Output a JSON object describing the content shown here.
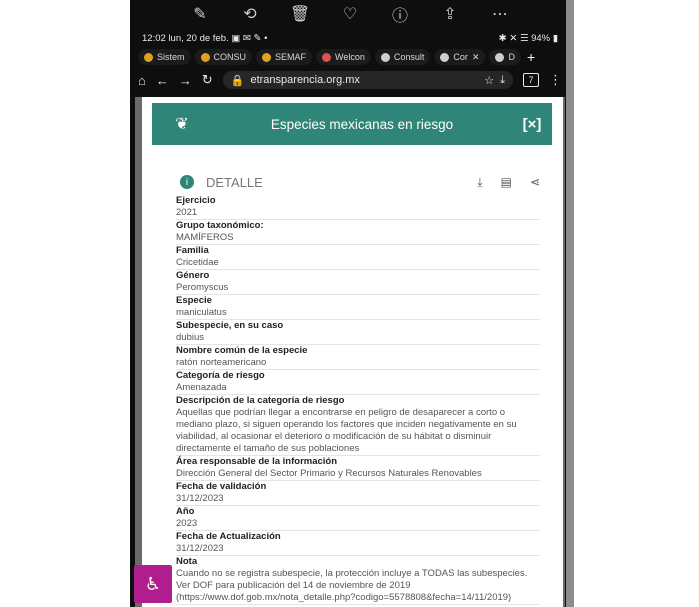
{
  "toolbar": {
    "icons": [
      "edit-icon",
      "rotate-icon",
      "trash-icon",
      "heart-icon",
      "info-icon",
      "share-icon",
      "more-icon"
    ]
  },
  "status_bar": {
    "time": "12:02",
    "date": "lun, 20 de feb.",
    "battery": "94%"
  },
  "browser": {
    "tabs": [
      "Sistem",
      "CONSU",
      "SEMAF",
      "Welcon",
      "Consult",
      "Cor",
      "D"
    ],
    "url": "etransparencia.org.mx",
    "tab_count": "7"
  },
  "page": {
    "title": "Especies mexicanas en riesgo",
    "close_label": "[×]",
    "detail_label": "DETALLE"
  },
  "fields": [
    {
      "label": "Ejercicio",
      "value": "2021"
    },
    {
      "label": "Grupo taxonómico:",
      "value": "MAMÍFEROS"
    },
    {
      "label": "Familia",
      "value": "Cricetidae"
    },
    {
      "label": "Género",
      "value": "Peromyscus"
    },
    {
      "label": "Especie",
      "value": "maniculatus"
    },
    {
      "label": "Subespecie, en su caso",
      "value": "dubius"
    },
    {
      "label": "Nombre común de la especie",
      "value": "ratón norteamericano"
    },
    {
      "label": "Categoría de riesgo",
      "value": "Amenazada"
    },
    {
      "label": "Descripción de la categoría de riesgo",
      "value": "Aquellas que podrían llegar a encontrarse en peligro de desaparecer a corto o mediano plazo, si siguen operando los factores que inciden negativamente en su viabilidad, al ocasionar el deterioro o modificación de su hábitat o disminuir directamente el tamaño de sus poblaciones"
    },
    {
      "label": "Área responsable de la información",
      "value": "Dirección General del Sector Primario y Recursos Naturales Renovables"
    },
    {
      "label": "Fecha de validación",
      "value": "31/12/2023"
    },
    {
      "label": "Año",
      "value": "2023"
    },
    {
      "label": "Fecha de Actualización",
      "value": "31/12/2023"
    },
    {
      "label": "Nota",
      "value": "Cuando no se registra subespecie, la protección incluye a TODAS las subespecies. Ver DOF para publicación del 14 de noviembre de 2019 (https://www.dof.gob.mx/nota_detalle.php?codigo=5578808&fecha=14/11/2019)"
    }
  ]
}
